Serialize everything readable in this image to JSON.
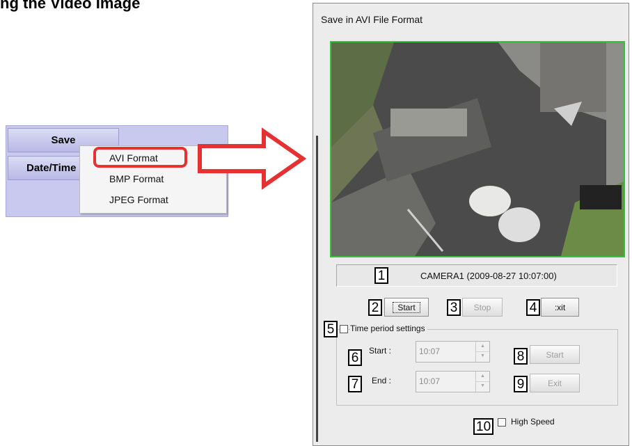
{
  "heading": "ng the Video Image",
  "left_menu": {
    "save_label": "Save",
    "datetime_label": "Date/Time",
    "context_menu": [
      "AVI Format",
      "BMP Format",
      "JPEG Format"
    ],
    "highlight_color": "#e53131"
  },
  "dialog": {
    "title": "Save in AVI File Format",
    "camera_status": "CAMERA1 (2009-08-27  10:07:00)",
    "start_button": "Start",
    "stop_button": "Stop",
    "exit_button": ":xit",
    "time_period_label": "Time period settings",
    "start_label": "Start :",
    "end_label": "End :",
    "start_time": "10:07",
    "end_time": "10:07",
    "period_start_button": "Start",
    "period_exit_button": "Exit",
    "high_speed_label": "High Speed"
  },
  "callouts": [
    "1",
    "2",
    "3",
    "4",
    "5",
    "6",
    "7",
    "8",
    "9",
    "10"
  ],
  "colors": {
    "arrow": "#e53131",
    "video_border": "#39c239",
    "menu_bg": "#c9c9ef"
  }
}
